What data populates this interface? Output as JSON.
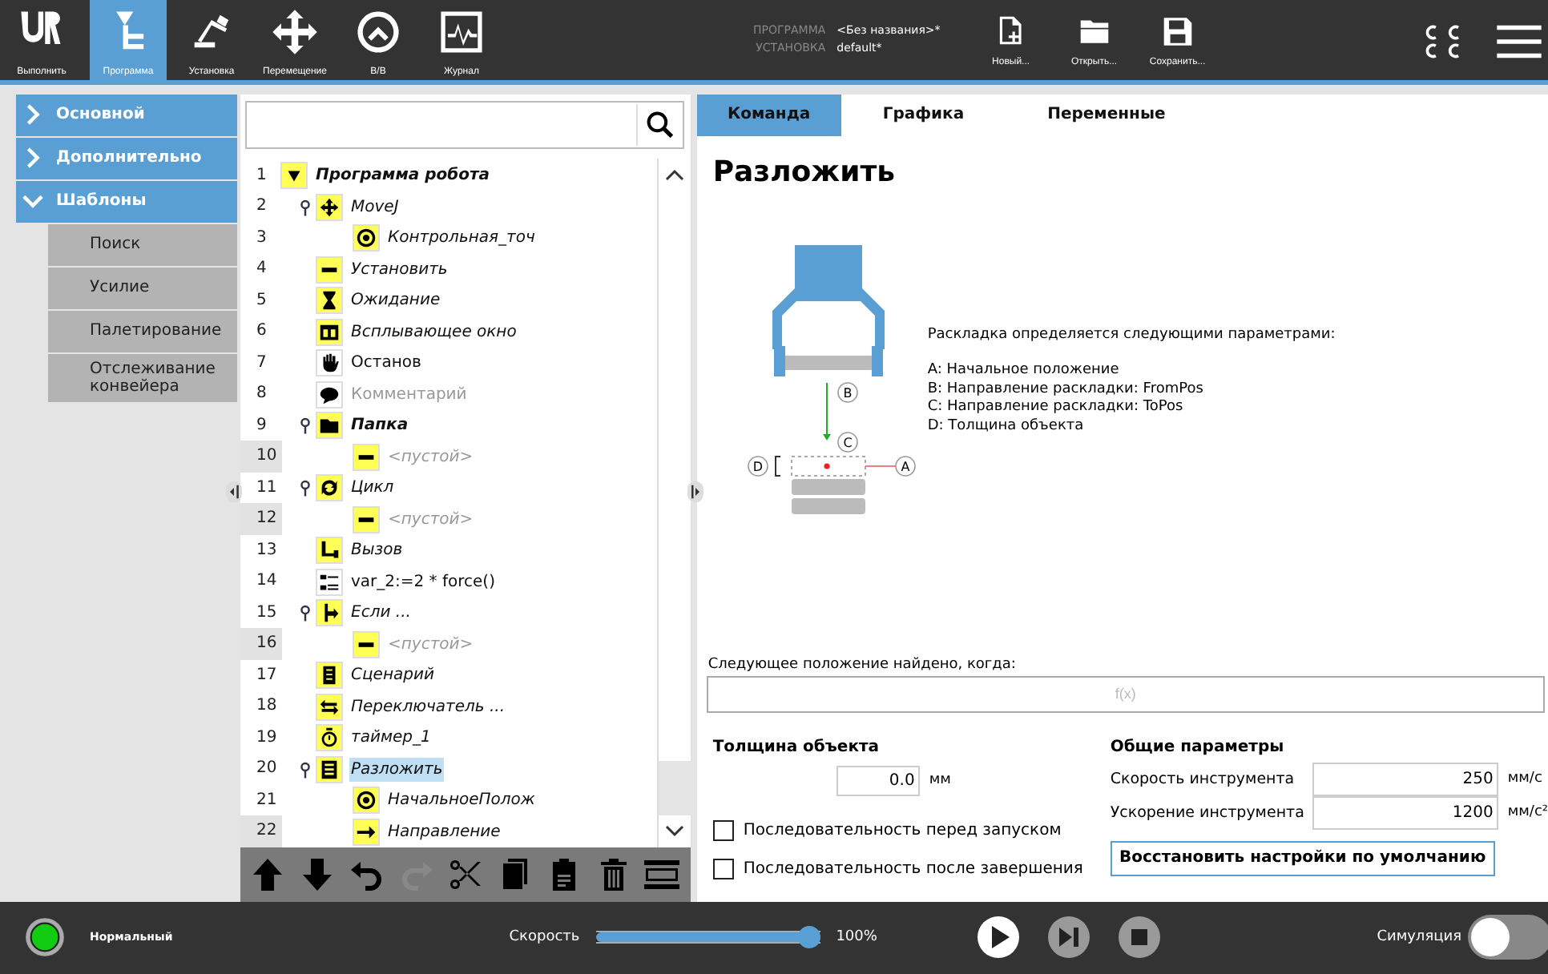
{
  "top_bar": {
    "nav": [
      {
        "kind": "logo",
        "label": "Выполнить",
        "selected": false
      },
      {
        "kind": "program",
        "label": "Программа",
        "selected": true
      },
      {
        "kind": "robot",
        "label": "Установка",
        "selected": false
      },
      {
        "kind": "move",
        "label": "Перемещение",
        "selected": false
      },
      {
        "kind": "io",
        "label": "В/В",
        "selected": false
      },
      {
        "kind": "log",
        "label": "Журнал",
        "selected": false
      }
    ],
    "program_label": "ПРОГРАММА",
    "program_value": "<Без названия>*",
    "installation_label": "УСТАНОВКА",
    "installation_value": "default*",
    "file_buttons": [
      {
        "kind": "new",
        "label": "Новый..."
      },
      {
        "kind": "open",
        "label": "Открыть..."
      },
      {
        "kind": "save",
        "label": "Сохранить..."
      }
    ]
  },
  "sidebar": {
    "items": [
      {
        "label": "Основной",
        "expanded": false
      },
      {
        "label": "Дополнительно",
        "expanded": false
      },
      {
        "label": "Шаблоны",
        "expanded": true,
        "children": [
          "Поиск",
          "Усилие",
          "Палетирование",
          "Отслеживание конвейера"
        ]
      }
    ]
  },
  "tree": {
    "nodes": [
      {
        "number": "1",
        "kind": "program",
        "text": "Программа робота",
        "shaded": false,
        "selected": false,
        "children": [
          {
            "number": "2",
            "kind": "move",
            "text": "MoveJ",
            "shaded": false,
            "selected": false,
            "children": [
              {
                "number": "3",
                "kind": "waypoint",
                "text": "Контрольная_точ",
                "shaded": false,
                "selected": false
              }
            ]
          },
          {
            "number": "4",
            "kind": "set",
            "text": "Установить",
            "shaded": false,
            "selected": false
          },
          {
            "number": "5",
            "kind": "wait",
            "text": "Ожидание",
            "shaded": false,
            "selected": false
          },
          {
            "number": "6",
            "kind": "popup",
            "text": "Всплывающее окно",
            "shaded": false,
            "selected": false
          },
          {
            "number": "7",
            "kind": "halt",
            "text": "Останов",
            "shaded": false,
            "selected": false
          },
          {
            "number": "8",
            "kind": "comment",
            "text": "Комментарий",
            "shaded": false,
            "selected": false
          },
          {
            "number": "9",
            "kind": "folder",
            "text": "Папка",
            "shaded": false,
            "selected": false,
            "children": [
              {
                "number": "10",
                "kind": "empty",
                "text": "<пустой>",
                "shaded": true,
                "selected": false
              }
            ]
          },
          {
            "number": "11",
            "kind": "loop",
            "text": "Цикл",
            "shaded": false,
            "selected": false,
            "children": [
              {
                "number": "12",
                "kind": "empty",
                "text": "<пустой>",
                "shaded": true,
                "selected": false
              }
            ]
          },
          {
            "number": "13",
            "kind": "call",
            "text": "Вызов",
            "shaded": false,
            "selected": false
          },
          {
            "number": "14",
            "kind": "assign",
            "text": "var_2:=2 * force()",
            "shaded": false,
            "selected": false
          },
          {
            "number": "15",
            "kind": "if",
            "text": "Если ...",
            "shaded": false,
            "selected": false,
            "children": [
              {
                "number": "16",
                "kind": "empty",
                "text": "<пустой>",
                "shaded": true,
                "selected": false
              }
            ]
          },
          {
            "number": "17",
            "kind": "script",
            "text": "Сценарий",
            "shaded": false,
            "selected": false
          },
          {
            "number": "18",
            "kind": "switch",
            "text": "Переключатель ...",
            "shaded": false,
            "selected": false
          },
          {
            "number": "19",
            "kind": "timer",
            "text": "таймер_1",
            "shaded": false,
            "selected": false
          },
          {
            "number": "20",
            "kind": "pallet",
            "text": "Разложить",
            "shaded": false,
            "selected": true,
            "children": [
              {
                "number": "21",
                "kind": "waypoint",
                "text": "НачальноеПолож",
                "shaded": false,
                "selected": false
              },
              {
                "number": "22",
                "kind": "direction",
                "text": "Направление",
                "shaded": true,
                "selected": false
              }
            ]
          }
        ]
      }
    ]
  },
  "toolbar": [
    {
      "kind": "up",
      "disabled": false
    },
    {
      "kind": "down",
      "disabled": false
    },
    {
      "kind": "undo",
      "disabled": false
    },
    {
      "kind": "redo",
      "disabled": true
    },
    {
      "kind": "cut",
      "disabled": false
    },
    {
      "kind": "copy",
      "disabled": false
    },
    {
      "kind": "paste",
      "disabled": false
    },
    {
      "kind": "delete",
      "disabled": false
    },
    {
      "kind": "suppress",
      "disabled": false
    }
  ],
  "tabs": [
    {
      "label": "Команда",
      "selected": true
    },
    {
      "label": "Графика",
      "selected": false
    },
    {
      "label": "Переменные",
      "selected": false
    }
  ],
  "title": "Разложить",
  "diagram": {
    "labels": [
      "A",
      "B",
      "C",
      "D"
    ]
  },
  "description": {
    "intro": "Раскладка определяется следующими параметрами:",
    "lines": [
      "A: Начальное положение",
      "B: Направление раскладки: FromPos",
      "C: Направление раскладки: ToPos",
      "D: Толщина объекта"
    ]
  },
  "condition": {
    "label": "Следующее положение найдено, когда:",
    "placeholder": "f(x)"
  },
  "thickness": {
    "heading": "Толщина объекта",
    "value": "0.0",
    "unit": "мм"
  },
  "checkboxes": [
    {
      "label": "Последовательность перед запуском",
      "checked": false
    },
    {
      "label": "Последовательность после завершения",
      "checked": false
    }
  ],
  "general": {
    "heading": "Общие параметры",
    "rows": [
      {
        "label": "Скорость инструмента",
        "value": "250",
        "unit": "мм/с"
      },
      {
        "label": "Ускорение инструмента",
        "value": "1200",
        "unit": "мм/с²"
      }
    ],
    "restore_button": "Восстановить настройки по умолчанию"
  },
  "bottom_bar": {
    "status": "Нормальный",
    "speed_label": "Скорость",
    "speed": {
      "level": 1.0
    },
    "speed_reading": "100%",
    "controls": [
      {
        "kind": "play"
      },
      {
        "kind": "step"
      },
      {
        "kind": "stop"
      }
    ],
    "simulation_label": "Симуляция",
    "simulation_on": false
  }
}
